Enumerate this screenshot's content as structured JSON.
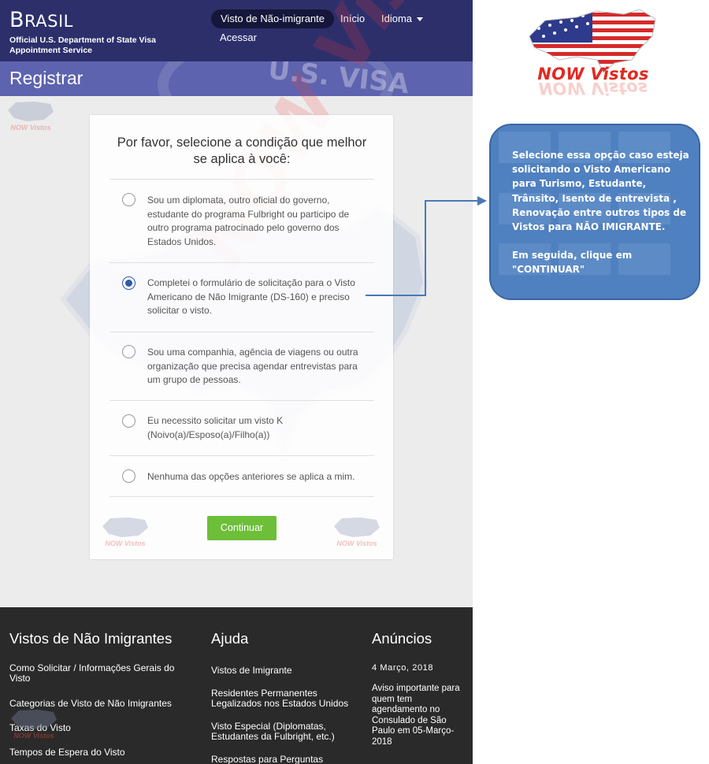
{
  "header": {
    "brand_first": "B",
    "brand_rest": "RASIL",
    "brand_sub": "Official U.S. Department of State Visa Appointment Service",
    "nav": {
      "active": "Visto de Não-imigrante",
      "inicio": "Início",
      "idioma": "Idioma",
      "acessar": "Acessar"
    }
  },
  "titlebar": {
    "title": "Registrar",
    "watermark": "U.S. VISA"
  },
  "form": {
    "heading": "Por favor, selecione a condição que melhor se aplica à você:",
    "options": [
      {
        "label": "Sou um diplomata, outro oficial do governo, estudante do programa Fulbright ou participo de outro programa patrocinado pelo governo dos Estados Unidos.",
        "selected": false
      },
      {
        "label": "Completei o formulário de solicitação para o Visto Americano de Não Imigrante (DS-160) e preciso solicitar o visto.",
        "selected": true
      },
      {
        "label": "Sou uma companhia, agência de viagens ou outra organização que precisa agendar entrevistas para um grupo de pessoas.",
        "selected": false
      },
      {
        "label": "Eu necessito solicitar um visto K (Noivo(a)/Esposo(a)/Filho(a))",
        "selected": false
      },
      {
        "label": "Nenhuma das opções anteriores se aplica a mim.",
        "selected": false
      }
    ],
    "continue_label": "Continuar"
  },
  "watermark_logo_text": "NOW Vistos",
  "footer": {
    "col1": {
      "heading": "Vistos de Não Imigrantes",
      "links": [
        "Como Solicitar / Informações Gerais do Visto",
        "Categorias de Visto de Não Imigrantes",
        "Taxas do Visto",
        "Tempos de Espera do Visto"
      ]
    },
    "col2": {
      "heading": "Ajuda",
      "links": [
        "Vistos de Imigrante",
        "Residentes Permanentes Legalizados nos Estados Unidos",
        "Visto Especial (Diplomatas, Estudantes da Fulbright, etc.)",
        "Respostas para Perguntas"
      ]
    },
    "col3": {
      "heading": "Anúncios",
      "date": "4 Março, 2018",
      "text": "Aviso importante para quem tem agendamento no Consulado de São Paulo em 05-Março-2018"
    }
  },
  "annotation": {
    "logo_text": "NOW Vistos",
    "callout_p1": "Selecione essa opção caso esteja solicitando o Visto Americano para Turismo, Estudante, Trânsito, Isento de entrevista , Renovação entre outros tipos de Vistos para NÃO IMIGRANTE.",
    "callout_p2": "Em seguida, clique em \"CONTINUAR\""
  },
  "colors": {
    "header_bg": "#2d2f6b",
    "titlebar_bg": "#5d63ae",
    "button_green": "#6dbf3a",
    "footer_bg": "#2a2a2a",
    "callout_blue": "#4f80c0",
    "logo_red": "#e02a22"
  }
}
